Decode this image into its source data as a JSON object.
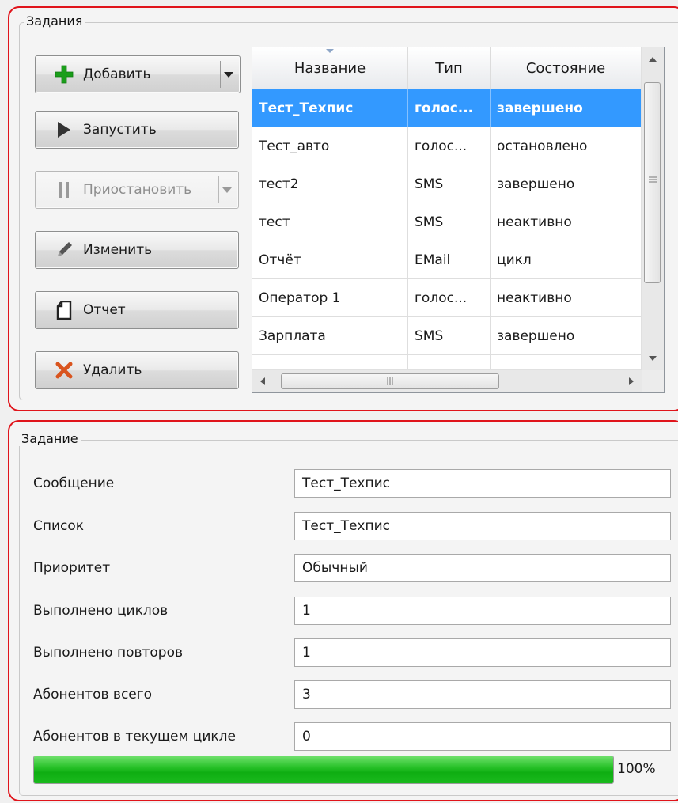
{
  "tasks_group": {
    "title": "Задания",
    "buttons": {
      "add": "Добавить",
      "run": "Запустить",
      "pause": "Приостановить",
      "edit": "Изменить",
      "report": "Отчет",
      "delete": "Удалить"
    },
    "table": {
      "columns": [
        "Название",
        "Тип",
        "Состояние"
      ],
      "rows": [
        [
          "Тест_Техпис",
          "голос...",
          "завершено"
        ],
        [
          "Тест_авто",
          "голос...",
          "остановлено"
        ],
        [
          "тест2",
          "SMS",
          "завершено"
        ],
        [
          "тест",
          "SMS",
          "неактивно"
        ],
        [
          "Отчёт",
          "EMail",
          "цикл"
        ],
        [
          "Оператор 1",
          "голос...",
          "неактивно"
        ],
        [
          "Зарплата",
          "SMS",
          "завершено"
        ]
      ],
      "selected_row": 0
    }
  },
  "task_group": {
    "title": "Задание",
    "fields": [
      {
        "label": "Сообщение",
        "value": "Тест_Техпис"
      },
      {
        "label": "Список",
        "value": "Тест_Техпис"
      },
      {
        "label": "Приоритет",
        "value": "Обычный"
      },
      {
        "label": "Выполнено циклов",
        "value": "1"
      },
      {
        "label": "Выполнено повторов",
        "value": "1"
      },
      {
        "label": "Абонентов всего",
        "value": "3"
      },
      {
        "label": "Абонентов в текущем цикле",
        "value": "0"
      }
    ],
    "progress": {
      "percent": 100,
      "label": "100%"
    }
  },
  "colors": {
    "panel_border": "#e0141b",
    "selection": "#3399ff",
    "progress": "#1aba1d",
    "add_icon": "#1a9e1a",
    "delete_icon": "#d9541e"
  },
  "icons": {
    "add": "plus-icon",
    "run": "play-icon",
    "pause": "pause-icon",
    "edit": "pencil-icon",
    "report": "document-icon",
    "delete": "cross-icon"
  }
}
